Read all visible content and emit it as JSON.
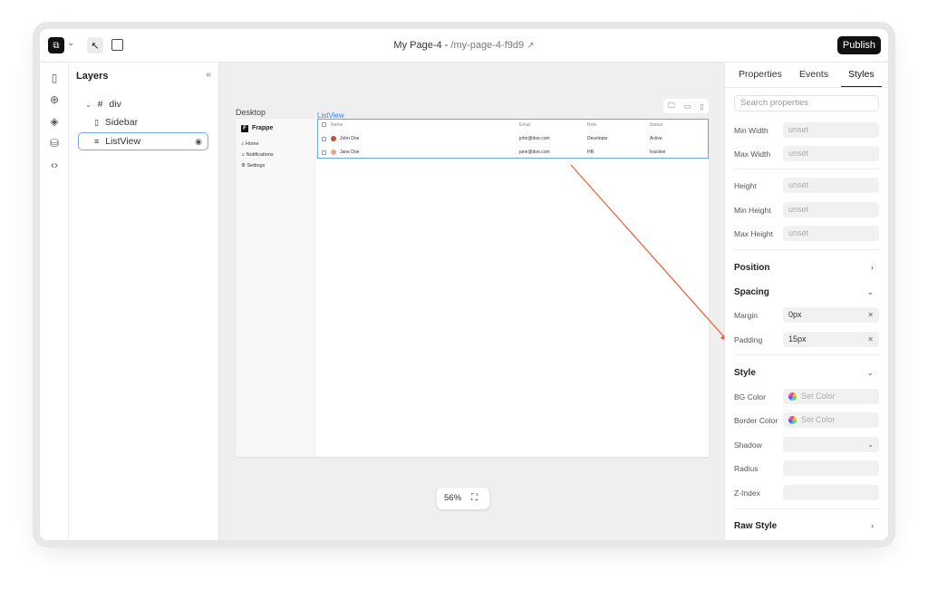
{
  "topbar": {
    "page_name": "My Page-4",
    "separator": "-",
    "page_slug": "/my-page-4-f9d9",
    "publish_label": "Publish"
  },
  "layers": {
    "title": "Layers",
    "items": [
      {
        "label": "div"
      },
      {
        "label": "Sidebar"
      },
      {
        "label": "ListView"
      }
    ]
  },
  "canvas": {
    "device_label": "Desktop",
    "selected_tag": "ListView",
    "zoom": "56%",
    "frame": {
      "brand": "Frappe",
      "nav": [
        "Home",
        "Notifications",
        "Settings"
      ],
      "columns": [
        "Name",
        "Email",
        "Role",
        "Status"
      ],
      "rows": [
        {
          "name": "John Doe",
          "email": "john@doe.com",
          "role": "Developer",
          "status": "Active"
        },
        {
          "name": "Jane Doe",
          "email": "jane@doe.com",
          "role": "HR",
          "status": "Inactive"
        }
      ]
    }
  },
  "panel": {
    "tabs": [
      "Properties",
      "Events",
      "Styles"
    ],
    "search_placeholder": "Search properties",
    "dimensions": [
      {
        "label": "Min Width",
        "value": "unset"
      },
      {
        "label": "Max Width",
        "value": "unset"
      },
      {
        "label": "Height",
        "value": "unset"
      },
      {
        "label": "Min Height",
        "value": "unset"
      },
      {
        "label": "Max Height",
        "value": "unset"
      }
    ],
    "position_title": "Position",
    "spacing_title": "Spacing",
    "margin_label": "Margin",
    "margin_value": "0px",
    "padding_label": "Padding",
    "padding_value": "15px",
    "style_title": "Style",
    "bg_color_label": "BG Color",
    "bg_color_value": "Set Color",
    "border_color_label": "Border Color",
    "border_color_value": "Set Color",
    "shadow_label": "Shadow",
    "radius_label": "Radius",
    "zindex_label": "Z-Index",
    "raw_style_title": "Raw Style"
  },
  "colors": {
    "selection": "#6aa4ef",
    "annotation_arrow": "#f05a3a"
  }
}
